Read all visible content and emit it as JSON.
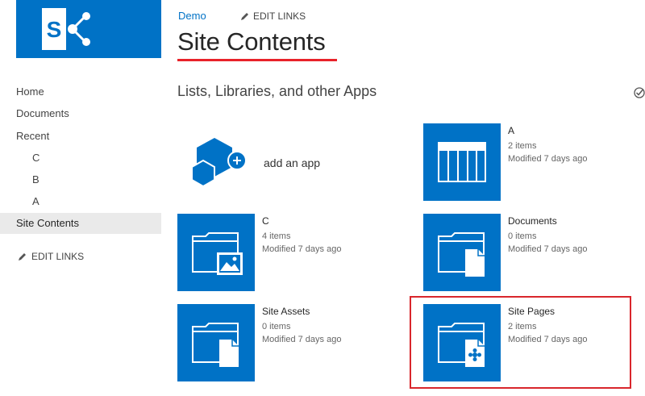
{
  "brand": {
    "accent": "#0072c6",
    "highlight": "#d9262c",
    "logo_letter": "S"
  },
  "topnav": {
    "breadcrumb": "Demo",
    "edit_links": "EDIT LINKS"
  },
  "page": {
    "title": "Site Contents"
  },
  "leftnav": {
    "items": [
      {
        "label": "Home",
        "level": 0,
        "selected": false
      },
      {
        "label": "Documents",
        "level": 0,
        "selected": false
      },
      {
        "label": "Recent",
        "level": 0,
        "selected": false
      },
      {
        "label": "C",
        "level": 1,
        "selected": false
      },
      {
        "label": "B",
        "level": 1,
        "selected": false
      },
      {
        "label": "A",
        "level": 1,
        "selected": false
      },
      {
        "label": "Site Contents",
        "level": 0,
        "selected": true
      }
    ],
    "edit_links": "EDIT LINKS"
  },
  "section": {
    "heading": "Lists, Libraries, and other Apps"
  },
  "add_app": {
    "label": "add an app",
    "icon": "add-app-icon"
  },
  "tiles": [
    {
      "name": "A",
      "count": "2 items",
      "modified": "Modified 7 days ago",
      "icon": "list-icon"
    },
    {
      "name": "C",
      "count": "4 items",
      "modified": "Modified 7 days ago",
      "icon": "picture-library-icon"
    },
    {
      "name": "Documents",
      "count": "0 items",
      "modified": "Modified 7 days ago",
      "icon": "document-library-icon"
    },
    {
      "name": "Site Assets",
      "count": "0 items",
      "modified": "Modified 7 days ago",
      "icon": "document-library-icon"
    },
    {
      "name": "Site Pages",
      "count": "2 items",
      "modified": "Modified 7 days ago",
      "icon": "wiki-page-library-icon"
    }
  ]
}
